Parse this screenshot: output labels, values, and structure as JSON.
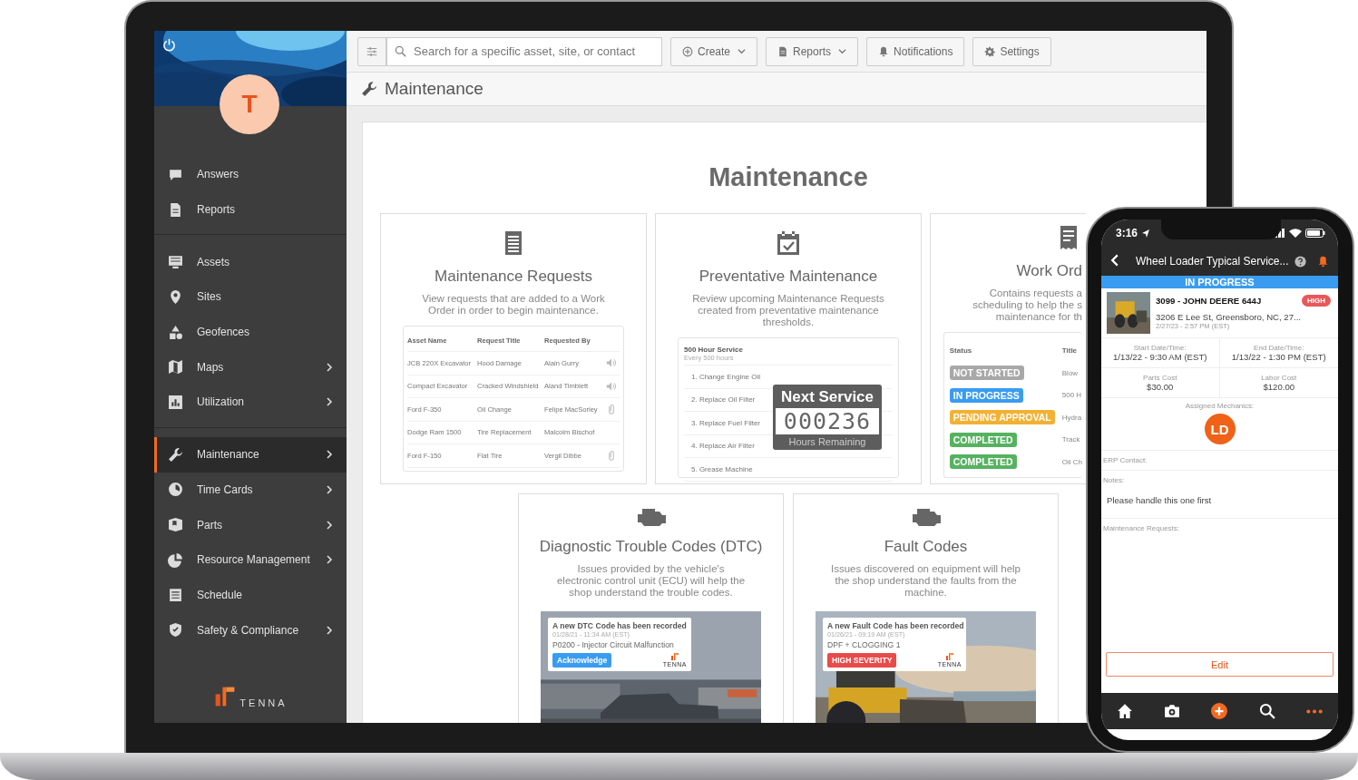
{
  "sidebar": {
    "avatar": "T",
    "sections": [
      {
        "items": [
          {
            "label": "Answers",
            "has_submenu": false,
            "selected": false
          },
          {
            "label": "Reports",
            "has_submenu": false,
            "selected": false
          }
        ]
      },
      {
        "items": [
          {
            "label": "Assets",
            "has_submenu": false,
            "selected": false
          },
          {
            "label": "Sites",
            "has_submenu": false,
            "selected": false
          },
          {
            "label": "Geofences",
            "has_submenu": false,
            "selected": false
          },
          {
            "label": "Maps",
            "has_submenu": true,
            "selected": false
          },
          {
            "label": "Utilization",
            "has_submenu": true,
            "selected": false
          }
        ]
      },
      {
        "items": [
          {
            "label": "Maintenance",
            "has_submenu": true,
            "selected": true
          },
          {
            "label": "Time Cards",
            "has_submenu": true,
            "selected": false
          },
          {
            "label": "Parts",
            "has_submenu": true,
            "selected": false
          },
          {
            "label": "Resource Management",
            "has_submenu": true,
            "selected": false
          },
          {
            "label": "Schedule",
            "has_submenu": false,
            "selected": false
          },
          {
            "label": "Safety & Compliance",
            "has_submenu": true,
            "selected": false
          }
        ]
      }
    ],
    "logo": "TENNA"
  },
  "toolbar": {
    "search": {
      "placeholder": "Search for a specific asset, site, or contact"
    },
    "buttons": [
      {
        "label": "Create",
        "dropdown": true
      },
      {
        "label": "Reports",
        "dropdown": true
      },
      {
        "label": "Notifications",
        "dropdown": false
      },
      {
        "label": "Settings",
        "dropdown": false
      }
    ]
  },
  "page_title": "Maintenance",
  "panel": {
    "heading": "Maintenance",
    "cards": [
      {
        "kind": "requests_table",
        "title": "Maintenance Requests",
        "description": [
          "View requests that are added to a Work",
          "Order in order to begin maintenance."
        ],
        "columns": [
          "Asset Name",
          "Request Title",
          "Requested By"
        ],
        "rows": [
          {
            "kind": "voice_note",
            "cells": [
              "JCB 220X Excavator",
              "Hood Damage",
              "Alain Gurry"
            ]
          },
          {
            "kind": "voice_note",
            "cells": [
              "Compact Excavator",
              "Cracked Windshield",
              "Aland Timblett"
            ]
          },
          {
            "kind": "attachment",
            "cells": [
              "Ford F-350",
              "Oil Change",
              "Felipe MacSorley"
            ]
          },
          {
            "kind": "plain",
            "cells": [
              "Dodge Ram 1500",
              "Tire Replacement",
              "Malcolm Bischof"
            ]
          },
          {
            "kind": "attachment",
            "cells": [
              "Ford F-150",
              "Flat Tire",
              "Vergil Dibbe"
            ]
          }
        ]
      },
      {
        "kind": "checklist",
        "title": "Preventative Maintenance",
        "description": [
          "Review upcoming Maintenance Requests",
          "created from preventative maintenance",
          "thresholds."
        ],
        "service_title": "500 Hour Service",
        "service_subtitle": "Every 500 hours",
        "steps": [
          "1.  Change Engine Oil",
          "2.  Replace Oil Filter",
          "3.  Replace Fuel Filter",
          "4.  Replace Air Filter",
          "5.  Grease Machine"
        ],
        "counter": {
          "title": "Next Service",
          "value": "000236",
          "caption": "Hours Remaining"
        }
      },
      {
        "kind": "status_table",
        "title": "Work Ord",
        "description": [
          "Contains requests a",
          "scheduling to help the s",
          "maintenance for th"
        ],
        "columns": [
          "Status",
          "Title"
        ],
        "rows": [
          {
            "status": "NOT STARTED",
            "color": "#a8a8a8",
            "title": "Blow"
          },
          {
            "status": "IN PROGRESS",
            "color": "#3a9cf0",
            "title": "500 H"
          },
          {
            "status": "PENDING APPROVAL",
            "color": "#f2b134",
            "title": "Hydra"
          },
          {
            "status": "COMPLETED",
            "color": "#56b260",
            "title": "Track"
          },
          {
            "status": "COMPLETED",
            "color": "#56b260",
            "title": "Oil Ch"
          }
        ]
      },
      {
        "kind": "alert",
        "title": "Diagnostic Trouble Codes (DTC)",
        "description": [
          "Issues provided by the vehicle's",
          "electronic control unit (ECU) will help the",
          "shop understand the trouble codes."
        ],
        "alert": {
          "heading": "A new DTC Code has been recorded",
          "time": "01/28/21 - 11:34 AM (EST)",
          "detail": "P0200 - Injector Circuit Malfunction",
          "action": "Acknowledge",
          "color": "#3a9cf0",
          "logo": "TENNA"
        }
      },
      {
        "kind": "alert",
        "title": "Fault Codes",
        "description": [
          "Issues discovered on equipment will help",
          "the shop understand the faults from the",
          "machine."
        ],
        "alert": {
          "heading": "A new Fault Code has been recorded",
          "time": "01/26/21 - 09:19 AM (EST)",
          "detail": "DPF + CLOGGING 1",
          "action": "HIGH SEVERITY",
          "color": "#e84b4b",
          "logo": "TENNA"
        }
      }
    ]
  },
  "phone": {
    "time": "3:16",
    "title": "Wheel Loader Typical Service...",
    "status": "IN PROGRESS",
    "asset": {
      "name": "3099 - JOHN DEERE 644J",
      "priority": "HIGH",
      "address": "3206 E Lee St, Greensboro, NC, 27...",
      "date": "2/27/23 - 2:57 PM (EST)"
    },
    "fields": [
      {
        "label": "Start Date/Time:",
        "value": "1/13/22 - 9:30 AM (EST)"
      },
      {
        "label": "End Date/Time:",
        "value": "1/13/22 - 1:30 PM (EST)"
      },
      {
        "label": "Parts Cost",
        "value": "$30.00"
      },
      {
        "label": "Labor Cost",
        "value": "$120.00"
      }
    ],
    "mechanics_label": "Assigned Mechanics:",
    "mechanics": [
      "LD"
    ],
    "erp_label": "ERP Contact:",
    "notes_label": "Notes:",
    "notes": "Please handle this one first",
    "requests_label": "Maintenance Requests:",
    "edit": "Edit",
    "tabs": [
      {
        "selected": false
      },
      {
        "selected": false
      },
      {
        "selected": false
      },
      {
        "selected": false
      },
      {
        "selected": true
      }
    ]
  }
}
